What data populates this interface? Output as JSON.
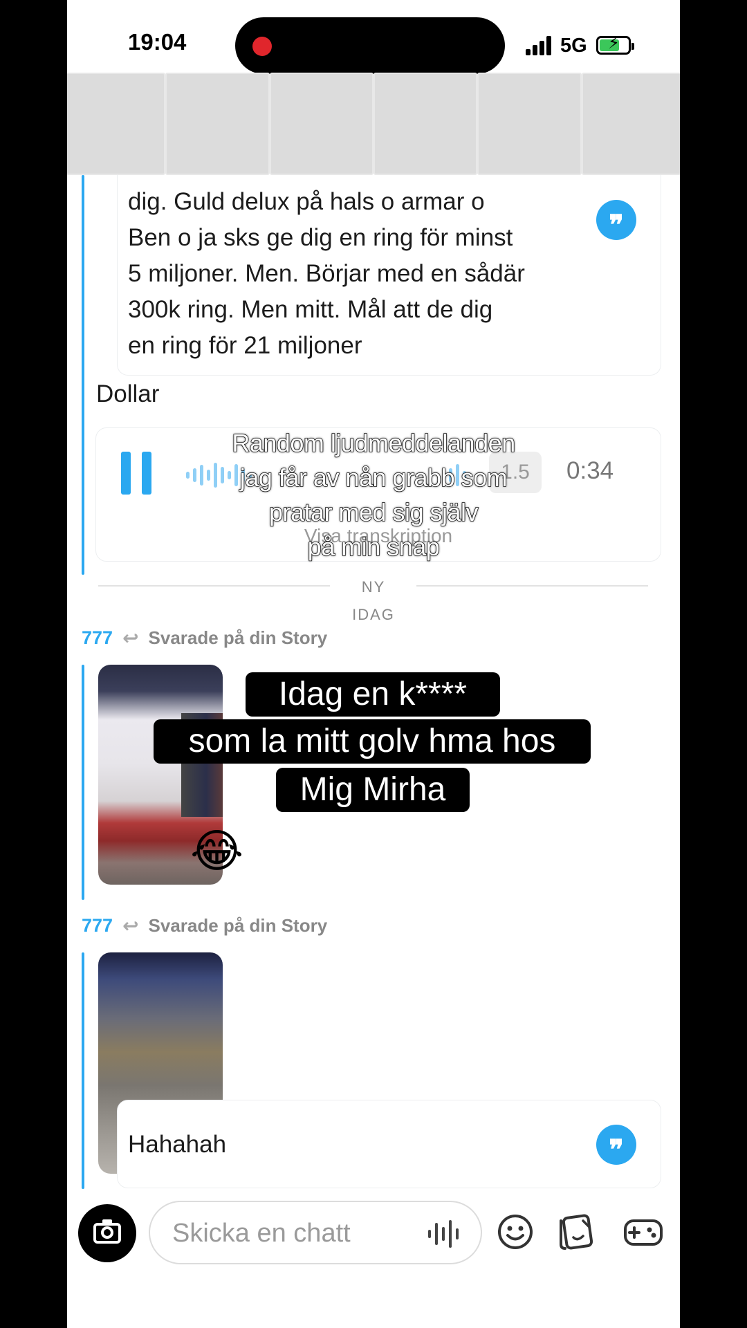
{
  "status_bar": {
    "time": "19:04",
    "network": "5G",
    "battery_state": "charging"
  },
  "messages": {
    "quoted_text_lines": [
      "dig. Guld delux på hals o armar o",
      "Ben o ja sks ge dig en ring för minst",
      "5 miljoner. Men. Börjar med  en sådär",
      "300k ring. Men mitt. Mål att de dig",
      "en ring för 21 miljoner"
    ],
    "plain_message": "Dollar",
    "audio": {
      "speed": "1.5",
      "duration": "0:34",
      "transcript_label": "Visa transkription"
    },
    "overlay_caption_lines": [
      "Random ljudmeddelanden",
      "jag får av nån grabb som",
      "pratar med sig själv",
      "på min snap"
    ],
    "divider_new": "NY",
    "divider_today": "IDAG",
    "reply1": {
      "user": "777",
      "action": "Svarade på din Story"
    },
    "story_caption_lines": [
      "Idag en k****",
      "som la mitt golv hma hos",
      "Mig Mirha"
    ],
    "emoji": "😂",
    "reply2": {
      "user": "777",
      "action": "Svarade på din Story",
      "text": "Hahahah"
    }
  },
  "chat_bar": {
    "placeholder": "Skicka en chatt"
  },
  "colors": {
    "accent": "#2ba8f0",
    "recording": "#e0262c",
    "battery": "#3bc75a"
  },
  "icons": [
    "camera-icon",
    "microphone-waveform-icon",
    "smiley-icon",
    "sticker-icon",
    "gamepad-icon",
    "quote-icon",
    "reply-arrow-icon",
    "pause-icon"
  ]
}
